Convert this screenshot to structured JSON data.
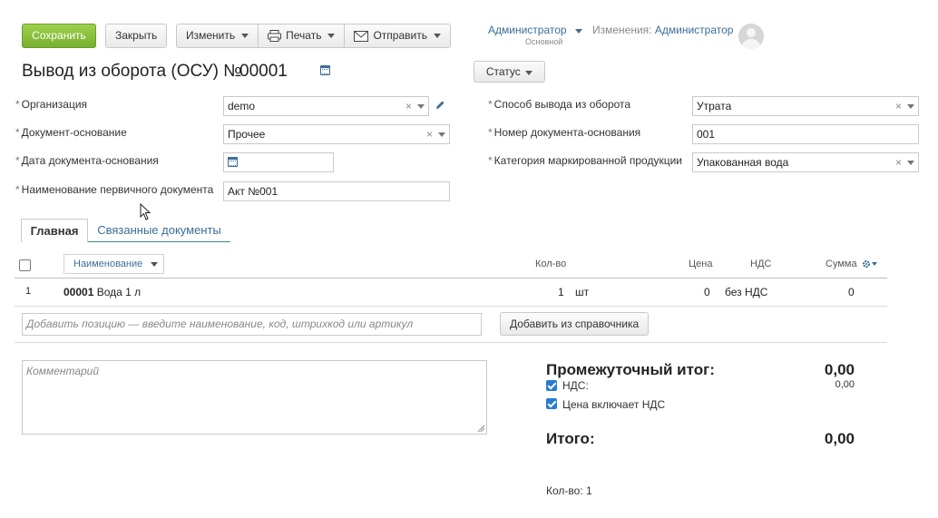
{
  "toolbar": {
    "save": "Сохранить",
    "close": "Закрыть",
    "edit": "Изменить",
    "print": "Печать",
    "send": "Отправить"
  },
  "user": {
    "name": "Администратор",
    "role": "Основной",
    "changes_label": "Изменения:",
    "changes_by": "Администратор"
  },
  "doc": {
    "title": "Вывод из оборота (ОСУ) №",
    "number": "00001",
    "status_button": "Статус"
  },
  "form": {
    "organization_label": "Организация",
    "organization_value": "demo",
    "base_doc_label": "Документ-основание",
    "base_doc_value": "Прочее",
    "base_date_label": "Дата документа-основания",
    "base_date_value": "",
    "primary_doc_label": "Наименование первичного документа",
    "primary_doc_value": "Акт №001",
    "method_label": "Способ вывода из оборота",
    "method_value": "Утрата",
    "base_num_label": "Номер документа-основания",
    "base_num_value": "001",
    "category_label": "Категория маркированной продукции",
    "category_value": "Упакованная вода"
  },
  "tabs": [
    {
      "label": "Главная"
    },
    {
      "label": "Связанные документы"
    }
  ],
  "table": {
    "headers": {
      "name": "Наименование",
      "qty": "Кол-во",
      "price": "Цена",
      "vat": "НДС",
      "sum": "Сумма"
    },
    "rows": [
      {
        "index": "1",
        "code": "00001",
        "name": "Вода 1 л",
        "qty": "1",
        "unit": "шт",
        "price": "0",
        "vat": "без НДС",
        "sum": "0"
      }
    ]
  },
  "add": {
    "placeholder": "Добавить позицию — введите наименование, код, штрихкод или артикул",
    "from_catalog": "Добавить из справочника"
  },
  "comment_placeholder": "Комментарий",
  "totals": {
    "subtotal_label": "Промежуточный итог:",
    "subtotal_value": "0,00",
    "vat_label": "НДС:",
    "vat_value": "0,00",
    "price_incl_vat_label": "Цена включает НДС",
    "total_label": "Итого:",
    "total_value": "0,00",
    "count_label": "Кол-во: 1"
  }
}
